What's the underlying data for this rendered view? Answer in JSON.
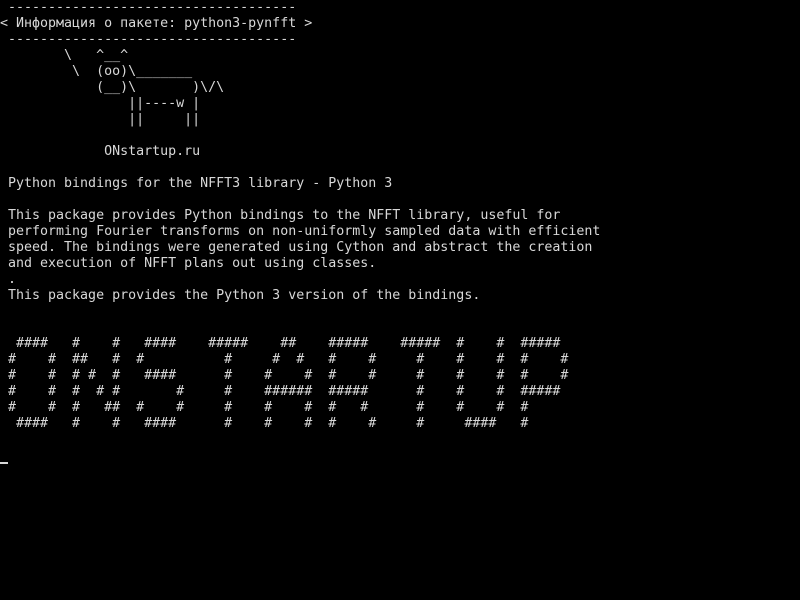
{
  "terminal": {
    "banner_top": " ------------------------------------",
    "banner_title": "< Информация о пакете: python3-pynfft >",
    "banner_bottom": " ------------------------------------",
    "cow": [
      "        \\   ^__^",
      "         \\  (oo)\\_______",
      "            (__)\\       )\\/\\",
      "                ||----w |",
      "                ||     ||"
    ],
    "site": "             ONstartup.ru",
    "summary": " Python bindings for the NFFT3 library - Python 3",
    "description": [
      " This package provides Python bindings to the NFFT library, useful for",
      " performing Fourier transforms on non-uniformly sampled data with efficient",
      " speed. The bindings were generated using Cython and abstract the creation",
      " and execution of NFFT plans out using classes.",
      " .",
      " This package provides the Python 3 version of the bindings."
    ],
    "ascii_art": [
      "  ####   #    #   ####    #####    ##    #####    #####  #    #  #####",
      " #    #  ##   #  #          #     #  #   #    #     #    #    #  #    #",
      " #    #  # #  #   ####      #    #    #  #    #     #    #    #  #    #",
      " #    #  #  # #       #     #    ######  #####      #    #    #  #####",
      " #    #  #   ##  #    #     #    #    #  #   #      #    #    #  #",
      "  ####   #    #   ####      #    #    #  #    #     #     ####   #"
    ]
  }
}
